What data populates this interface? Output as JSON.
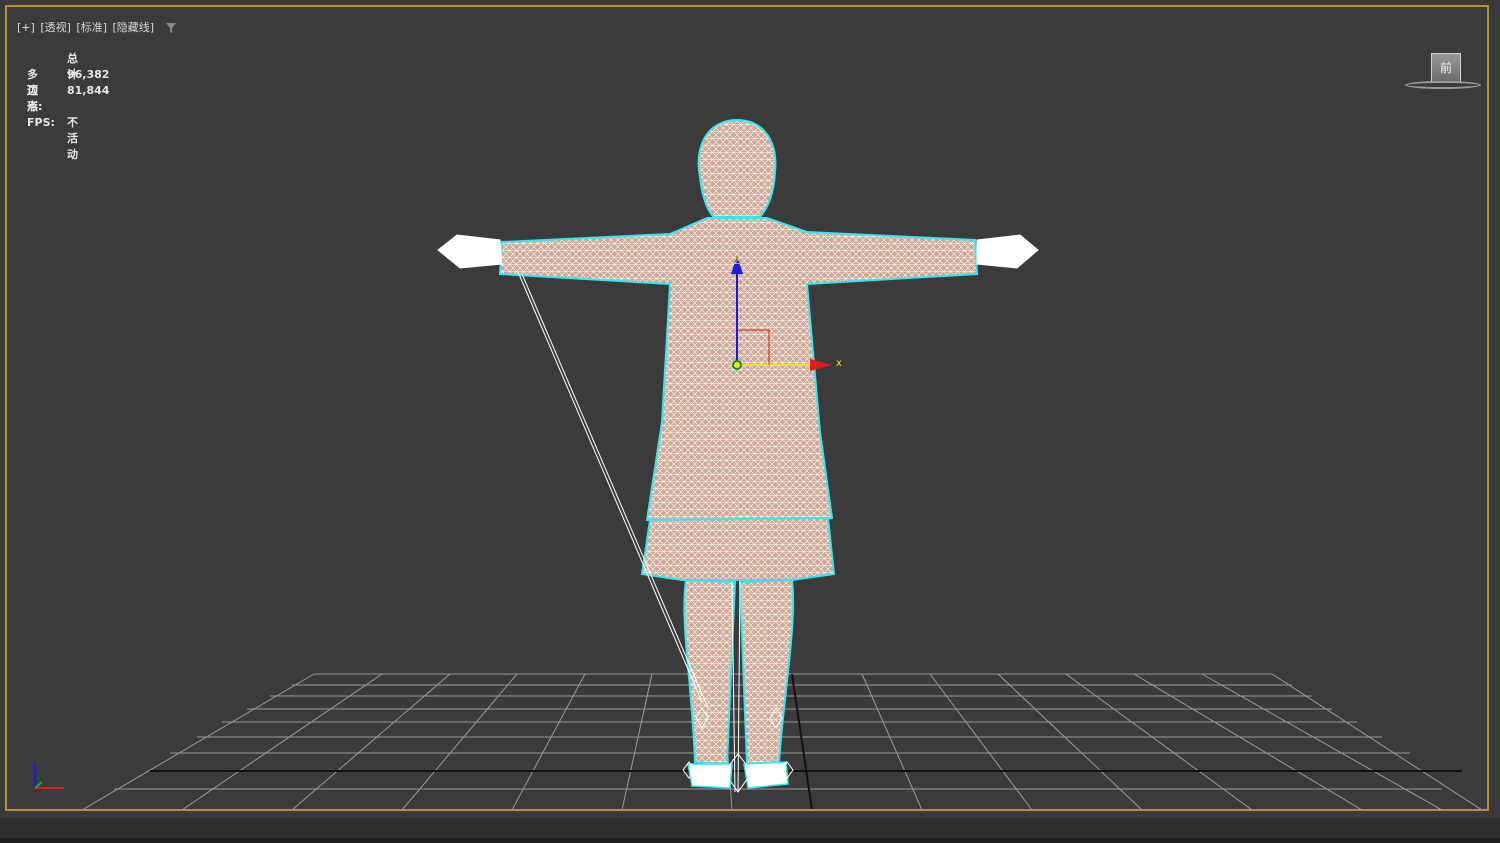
{
  "viewport": {
    "labels": {
      "plus": "[+]",
      "view": "[透视]",
      "shading": "[标准]",
      "mode": "[隐藏线]"
    },
    "stats": {
      "header": "总计",
      "polygons_label": "多边形:",
      "polygons_value": "96,382",
      "vertices_label": "顶点:",
      "vertices_value": "81,844",
      "fps_label": "FPS:",
      "fps_value": "不活动"
    },
    "viewcube_face": "前",
    "gizmo": {
      "x_label": "x",
      "z_label": "z"
    },
    "colors": {
      "border": "#b8942e",
      "background": "#3b3b3b",
      "selection_outline": "#33e6f2",
      "wire": "#ffffff",
      "grid": "#9a9a9a",
      "axis_x": "#e01b1b",
      "axis_y": "#f0e51a",
      "axis_z": "#1b1bd6"
    }
  }
}
